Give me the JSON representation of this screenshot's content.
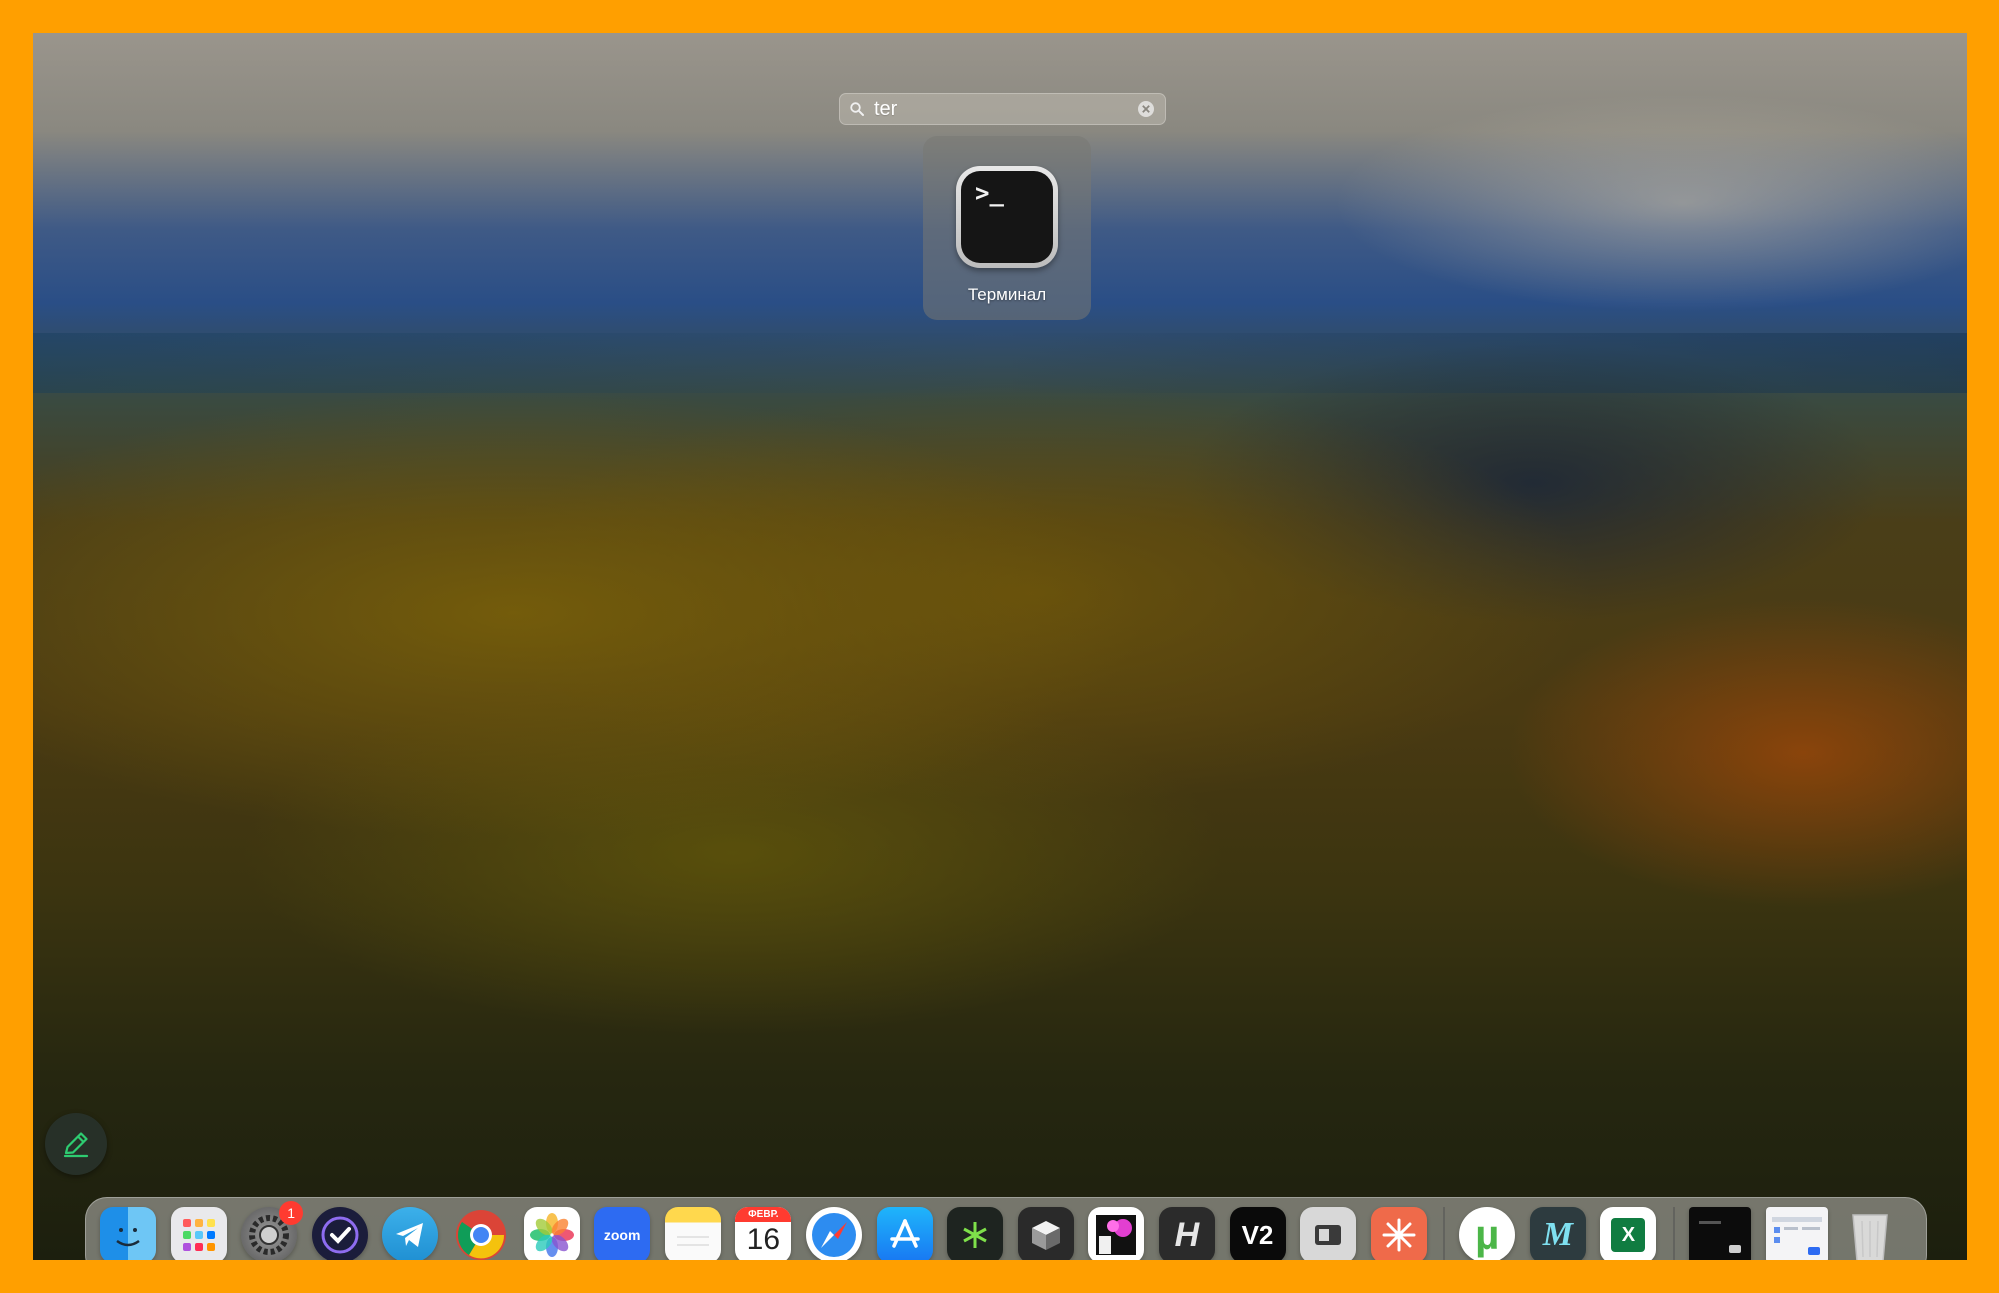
{
  "search": {
    "value": "ter",
    "icon": "search-icon",
    "clear_icon": "clear-icon"
  },
  "result": {
    "label": "Терминал",
    "icon": "terminal-icon",
    "glyph": ">_"
  },
  "floating_button": {
    "icon": "pencil-icon",
    "color": "#2ecc71"
  },
  "dock": {
    "items": [
      {
        "name": "finder",
        "icon": "finder-icon"
      },
      {
        "name": "launchpad",
        "icon": "launchpad-icon"
      },
      {
        "name": "system-settings",
        "icon": "gear-icon",
        "badge": "1"
      },
      {
        "name": "omnifocus",
        "icon": "checkmark-icon"
      },
      {
        "name": "telegram",
        "icon": "paper-plane-icon"
      },
      {
        "name": "chrome",
        "icon": "chrome-icon"
      },
      {
        "name": "photos",
        "icon": "photos-icon"
      },
      {
        "name": "zoom",
        "icon": "zoom-icon",
        "text": "zoom"
      },
      {
        "name": "notes",
        "icon": "notes-icon"
      },
      {
        "name": "calendar",
        "icon": "calendar-icon",
        "month": "ФЕВР.",
        "day": "16"
      },
      {
        "name": "safari",
        "icon": "compass-icon"
      },
      {
        "name": "app-store",
        "icon": "app-store-icon"
      },
      {
        "name": "app-green",
        "icon": "asterisk-icon"
      },
      {
        "name": "app-cube",
        "icon": "cube-icon"
      },
      {
        "name": "app-pixel",
        "icon": "pixel-art-icon"
      },
      {
        "name": "app-h",
        "icon": "h-letter-icon",
        "text": "H"
      },
      {
        "name": "app-v2",
        "icon": "v2-icon",
        "text": "V2"
      },
      {
        "name": "app-window",
        "icon": "window-icon"
      },
      {
        "name": "app-burst",
        "icon": "burst-icon"
      },
      {
        "name": "utorrent",
        "icon": "utorrent-icon",
        "text": "µ"
      },
      {
        "name": "app-m",
        "icon": "m-letter-icon",
        "text": "M"
      },
      {
        "name": "excel",
        "icon": "excel-icon",
        "text": "X"
      },
      {
        "name": "recent-window-1",
        "icon": "window-thumbnail-icon"
      },
      {
        "name": "recent-window-2",
        "icon": "window-thumbnail-icon"
      },
      {
        "name": "trash",
        "icon": "trash-icon"
      }
    ]
  }
}
